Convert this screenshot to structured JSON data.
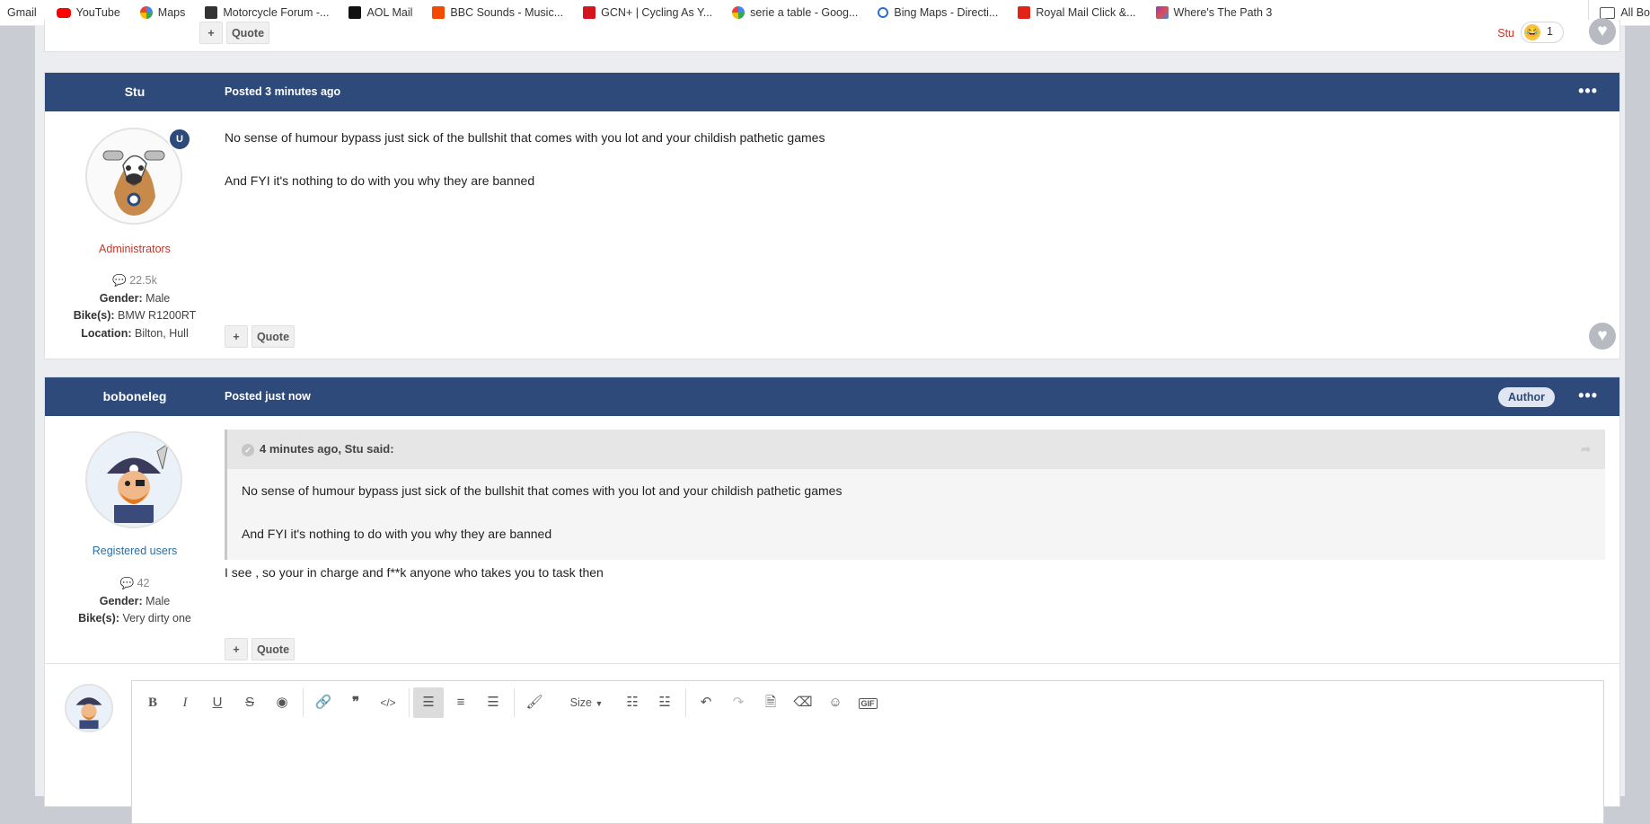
{
  "bookmarks": [
    {
      "label": "Gmail",
      "icon": "gmail-icon",
      "color": "#ea4335"
    },
    {
      "label": "YouTube",
      "icon": "youtube-icon",
      "color": "#ff0000"
    },
    {
      "label": "Maps",
      "icon": "google-icon",
      "color": "#4285f4"
    },
    {
      "label": "Motorcycle Forum -...",
      "icon": "motorcycle-icon",
      "color": "#333333"
    },
    {
      "label": "AOL Mail",
      "icon": "aol-icon",
      "color": "#111111"
    },
    {
      "label": "BBC Sounds - Music...",
      "icon": "bbc-sounds-icon",
      "color": "#f54900"
    },
    {
      "label": "GCN+ | Cycling As Y...",
      "icon": "gcn-icon",
      "color": "#d4141f"
    },
    {
      "label": "serie a table - Goog...",
      "icon": "google-icon",
      "color": "#4285f4"
    },
    {
      "label": "Bing Maps - Directi...",
      "icon": "bing-search-icon",
      "color": "#2b6fd1"
    },
    {
      "label": "Royal Mail Click &...",
      "icon": "royal-mail-icon",
      "color": "#e2231a"
    },
    {
      "label": "Where's The Path 3",
      "icon": "map-tiles-icon",
      "color": "#8a3cc2"
    }
  ],
  "all_bookmarks_label": "All Bo",
  "prev_post": {
    "quote_label": "Quote",
    "reaction_user": "Stu",
    "reaction_count": "1"
  },
  "post1": {
    "author": "Stu",
    "posted": "Posted 3 minutes ago",
    "group": "Administrators",
    "group_color": "#c0392b",
    "post_count": "22.5k",
    "gender_label": "Gender:",
    "gender": "Male",
    "bike_label": "Bike(s):",
    "bike": "BMW R1200RT",
    "location_label": "Location:",
    "location": "Bilton, Hull",
    "line1": "No sense of humour bypass just sick of the bullshit that comes with you lot and your childish pathetic games",
    "line2": "And FYI it's nothing to do with you why they are banned",
    "quote_label": "Quote"
  },
  "post2": {
    "author": "boboneleg",
    "posted": "Posted just now",
    "badge": "Author",
    "group": "Registered users",
    "group_color": "#2c6da3",
    "post_count": "42",
    "gender_label": "Gender:",
    "gender": "Male",
    "bike_label": "Bike(s):",
    "bike": "Very dirty one",
    "quote_header": "4 minutes ago, Stu said:",
    "quote_line1": "No sense of humour bypass just sick of the bullshit that comes with you lot and your childish pathetic games",
    "quote_line2": "And FYI it's nothing to do with you why they are banned",
    "reply": "I see , so your in charge and f**k anyone who takes you to task then",
    "quote_label": "Quote"
  },
  "editor": {
    "bold": "B",
    "italic": "I",
    "underline": "U",
    "strike": "S",
    "size_label": "Size",
    "gif_label": "GIF"
  },
  "colors": {
    "header_bar": "#2e4a7a"
  }
}
